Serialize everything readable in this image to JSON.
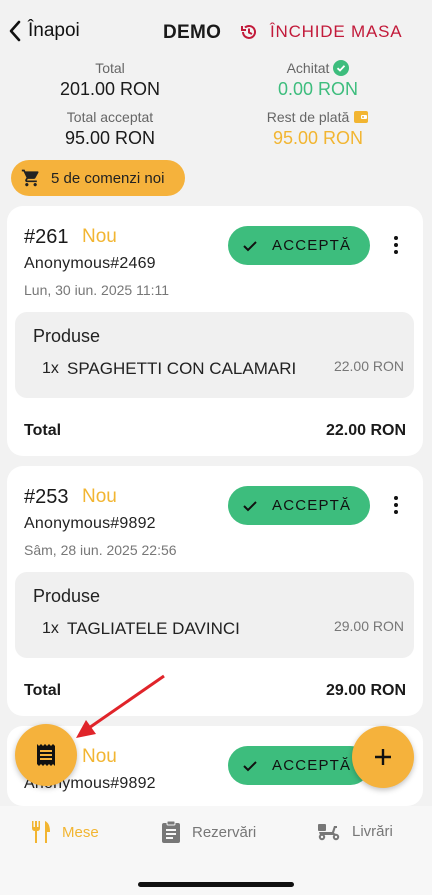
{
  "header": {
    "back_label": "Înapoi",
    "title": "DEMO",
    "close_table_label": "ÎNCHIDE MASA"
  },
  "stats": {
    "total_label": "Total",
    "total_value": "201.00 RON",
    "paid_label": "Achitat",
    "paid_value": "0.00 RON",
    "accepted_label": "Total acceptat",
    "accepted_value": "95.00 RON",
    "remaining_label": "Rest de plată",
    "remaining_value": "95.00 RON"
  },
  "new_orders_label": "5 de comenzi noi",
  "orders": [
    {
      "number": "#261",
      "status": "Nou",
      "customer": "Anonymous#2469",
      "date": "Lun, 30 iun. 2025 11:11",
      "accept_label": "ACCEPTĂ",
      "products_header": "Produse",
      "items": [
        {
          "qty": "1x",
          "name": "SPAGHETTI CON CALAMARI",
          "price": "22.00 RON"
        }
      ],
      "total_label": "Total",
      "total_value": "22.00 RON"
    },
    {
      "number": "#253",
      "status": "Nou",
      "customer": "Anonymous#9892",
      "date": "Sâm, 28 iun. 2025 22:56",
      "accept_label": "ACCEPTĂ",
      "products_header": "Produse",
      "items": [
        {
          "qty": "1x",
          "name": "TAGLIATELE DAVINCI",
          "price": "29.00 RON"
        }
      ],
      "total_label": "Total",
      "total_value": "29.00 RON"
    },
    {
      "status": "Nou",
      "customer": "Anonymous#9892",
      "accept_label": "ACCEPTĂ"
    }
  ],
  "nav": {
    "mese": "Mese",
    "rezervari": "Rezervări",
    "livrari": "Livrări"
  },
  "colors": {
    "accent": "#f5b23c",
    "accept_green": "#3dbd7d",
    "close_red": "#c21a3a"
  },
  "icons": {
    "back": "chevron-left-icon",
    "close_table": "history-icon",
    "paid": "check-circle-icon",
    "remaining": "wallet-icon",
    "cart": "cart-icon",
    "accept": "check-icon",
    "more": "more-vertical-icon",
    "receipt": "receipt-icon",
    "add": "plus-icon",
    "mese": "cutlery-icon",
    "rezervari": "clipboard-icon",
    "livrari": "scooter-icon"
  }
}
